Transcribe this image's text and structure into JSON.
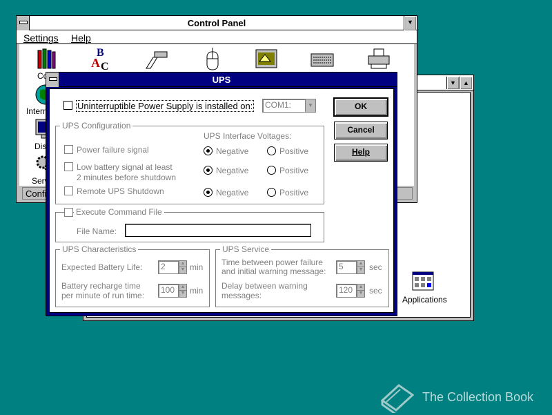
{
  "control_panel": {
    "title": "Control Panel",
    "menu": [
      "Settings",
      "Help"
    ],
    "side_labels": [
      "Co",
      "Internat",
      "Dis",
      "Serv"
    ],
    "status": "Confi"
  },
  "back_window": {
    "applications_label": "Applications"
  },
  "ups": {
    "title": "UPS",
    "installed_label": "Uninterruptible Power Supply is installed on:",
    "port_value": "COM1:",
    "buttons": {
      "ok": "OK",
      "cancel": "Cancel",
      "help": "Help"
    },
    "config": {
      "title": "UPS Configuration",
      "voltages_title": "UPS Interface Voltages:",
      "options": [
        {
          "label": "Power failure signal",
          "negative": "Negative",
          "positive": "Positive"
        },
        {
          "label": "Low battery signal at least",
          "label2": "2 minutes before shutdown",
          "negative": "Negative",
          "positive": "Positive"
        },
        {
          "label": "Remote UPS Shutdown",
          "negative": "Negative",
          "positive": "Positive"
        }
      ]
    },
    "command": {
      "title": "Execute Command File",
      "file_label": "File Name:",
      "file_value": ""
    },
    "characteristics": {
      "title": "UPS Characteristics",
      "battery_life_label": "Expected  Battery Life:",
      "battery_life_value": "2",
      "battery_life_unit": "min",
      "recharge_label1": "Battery recharge time",
      "recharge_label2": "per minute of run time:",
      "recharge_value": "100",
      "recharge_unit": "min"
    },
    "service": {
      "title": "UPS Service",
      "time_label1": "Time between power failure",
      "time_label2": "and initial warning message:",
      "time_value": "5",
      "time_unit": "sec",
      "delay_label1": "Delay between warning",
      "delay_label2": "messages:",
      "delay_value": "120",
      "delay_unit": "sec"
    }
  },
  "watermark": "The Collection Book"
}
